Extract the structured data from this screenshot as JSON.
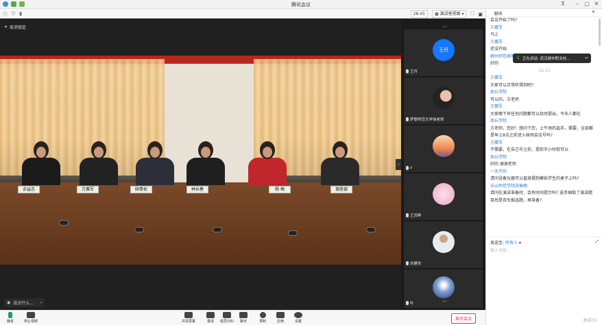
{
  "window": {
    "title": "腾讯会议"
  },
  "toolbar": {
    "timer": "28:45",
    "view_label": "演讲者视图"
  },
  "stage": {
    "cancel_lock": "取消锁定",
    "speak_hint": "说点什么..."
  },
  "video": {
    "nameplates": [
      "余益志",
      "方赛军",
      "顾青松",
      "林长春",
      "杨 梅",
      "袁胜银"
    ]
  },
  "gallery": {
    "tiles": [
      {
        "label": "王丹",
        "avatar_text": "王丹",
        "avatar_color": "#1677ff"
      },
      {
        "label": "萨黎师范大学徐老师",
        "avatar_color": "#222222"
      },
      {
        "label": "z",
        "avatar_color": "#f0a77a"
      },
      {
        "label": "王苏畔",
        "avatar_color": "#f2bfd5"
      },
      {
        "label": "刘建东",
        "avatar_color": "#d9dbe0"
      },
      {
        "label": "叶",
        "avatar_color": "#9fb8e4"
      }
    ]
  },
  "bottom": {
    "buttons": [
      "静音",
      "停止视频",
      "共享屏幕",
      "邀请",
      "成员(56)",
      "聊天",
      "录制",
      "应用",
      "设置"
    ],
    "leave": "离开会议"
  },
  "chat": {
    "title": "聊天",
    "messages": [
      {
        "type": "text",
        "text": "会议开始了吗?"
      },
      {
        "type": "name",
        "text": "方赛军"
      },
      {
        "type": "text",
        "text": "马上"
      },
      {
        "type": "name",
        "text": "方赛军"
      },
      {
        "type": "text",
        "text": "还没开始"
      },
      {
        "type": "name",
        "text": "赣州师范高等专科学校"
      },
      {
        "type": "text",
        "text": "好的"
      },
      {
        "type": "time",
        "text": "15:11"
      },
      {
        "type": "name",
        "text": "方赛军"
      },
      {
        "type": "text",
        "text": "大家可以正常听得到吧?"
      },
      {
        "type": "name",
        "text": "商丘学院"
      },
      {
        "type": "text",
        "text": "可以的，方老师"
      },
      {
        "type": "name",
        "text": "方赛军"
      },
      {
        "type": "text",
        "text": "大家哪下有任何问题都可以及时提出，今天人都在"
      },
      {
        "type": "name",
        "text": "商丘学院"
      },
      {
        "type": "text",
        "text": "方老师，您好！想问下您，上午场的选手，需要，全部都"
      },
      {
        "type": "text",
        "text": "是早上8点之前进入候场会议号吗?"
      },
      {
        "type": "name",
        "text": "方赛军"
      },
      {
        "type": "text",
        "text": "不需要，在自己号之前，提前半小时就可以"
      },
      {
        "type": "name",
        "text": "商丘学院"
      },
      {
        "type": "text",
        "text": "好的  谢谢老师"
      },
      {
        "type": "name",
        "text": "一天不的"
      },
      {
        "type": "text",
        "text": "请问设备仪器可以直接摆到模拟学生的桌子上吗?"
      },
      {
        "type": "name",
        "text": "乐山师范学院张振梅"
      },
      {
        "type": "text",
        "text": "请问在演讲准备时，会有时间提示吗? 选手抽取了演讲题"
      },
      {
        "type": "text",
        "text": "目后是否先报选题，再准备?"
      }
    ],
    "send_to_label": "发送至:",
    "send_to_value": "所有人",
    "placeholder": "输入消息...",
    "send": "发送(S)"
  },
  "toast": {
    "text": "正在讲话: 武汉城市职业技..."
  }
}
